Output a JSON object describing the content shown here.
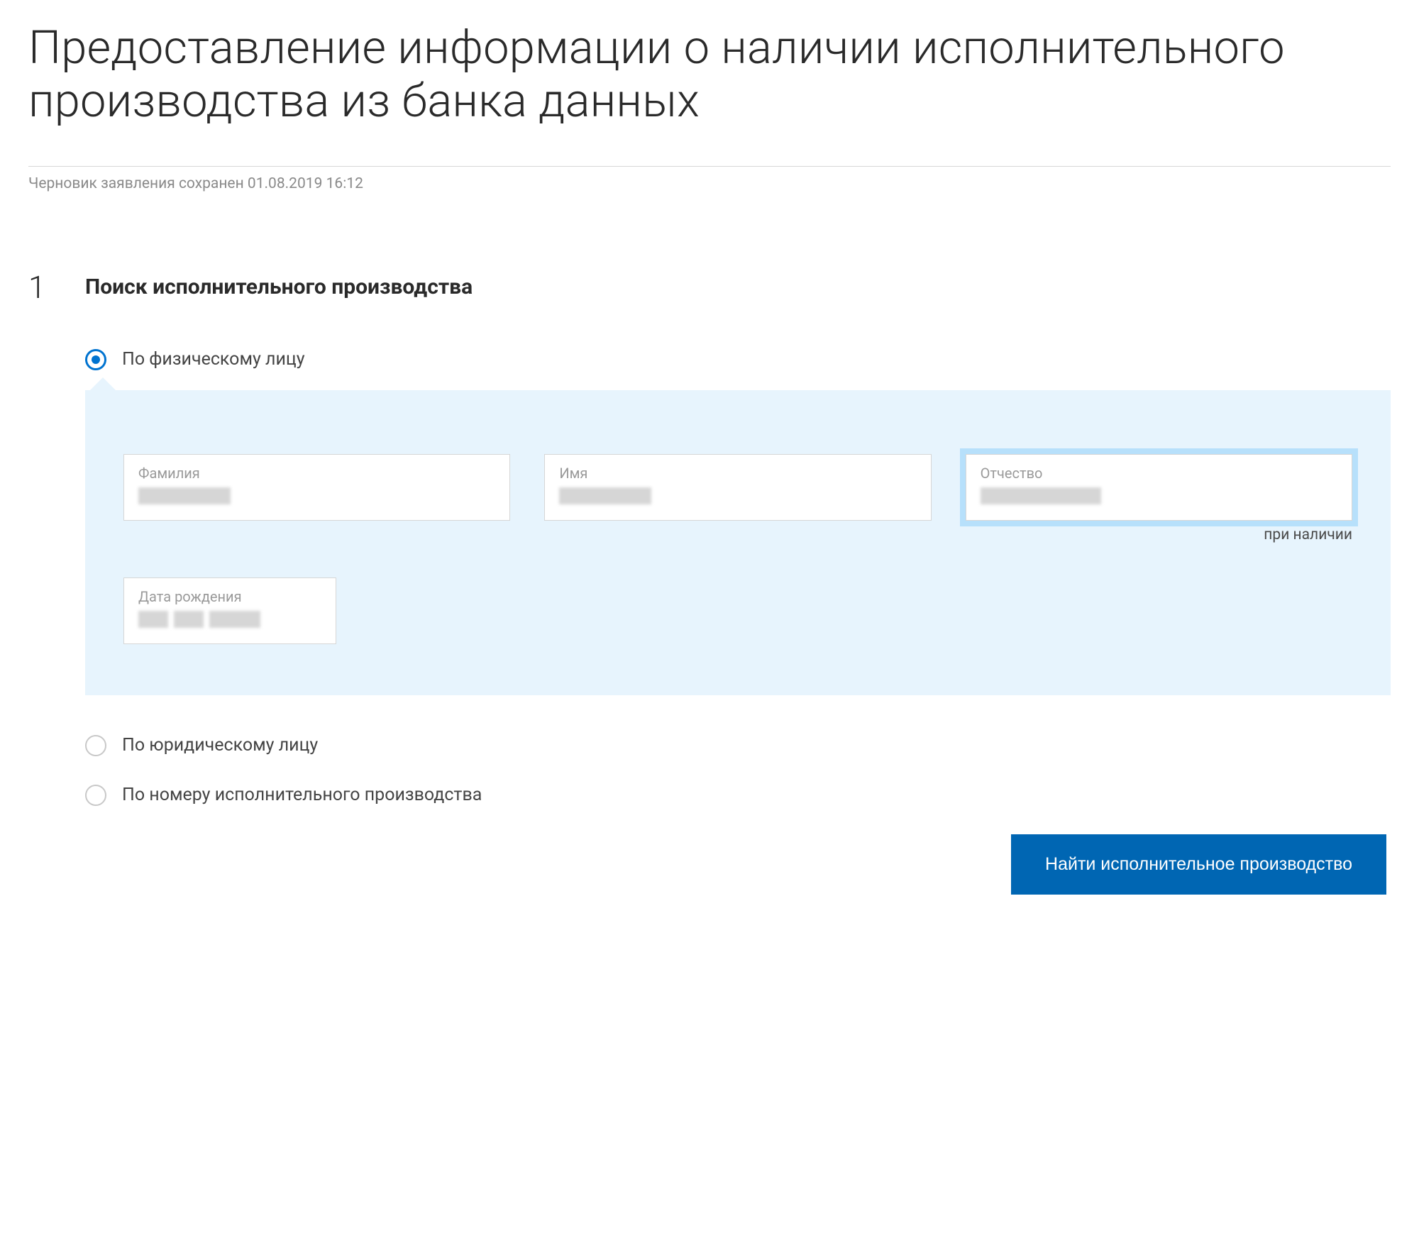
{
  "title": "Предоставление информации о наличии исполнительного производства из банка данных",
  "draft_status": "Черновик заявления сохранен 01.08.2019 16:12",
  "step": {
    "number": "1",
    "heading": "Поиск исполнительного производства"
  },
  "options": {
    "physical": "По физическому лицу",
    "legal": "По юридическому лицу",
    "by_number": "По номеру исполнительного производства"
  },
  "fields": {
    "lastname_label": "Фамилия",
    "firstname_label": "Имя",
    "patronymic_label": "Отчество",
    "patronymic_hint": "при наличии",
    "dob_label": "Дата рождения"
  },
  "submit_label": "Найти исполнительное производство"
}
